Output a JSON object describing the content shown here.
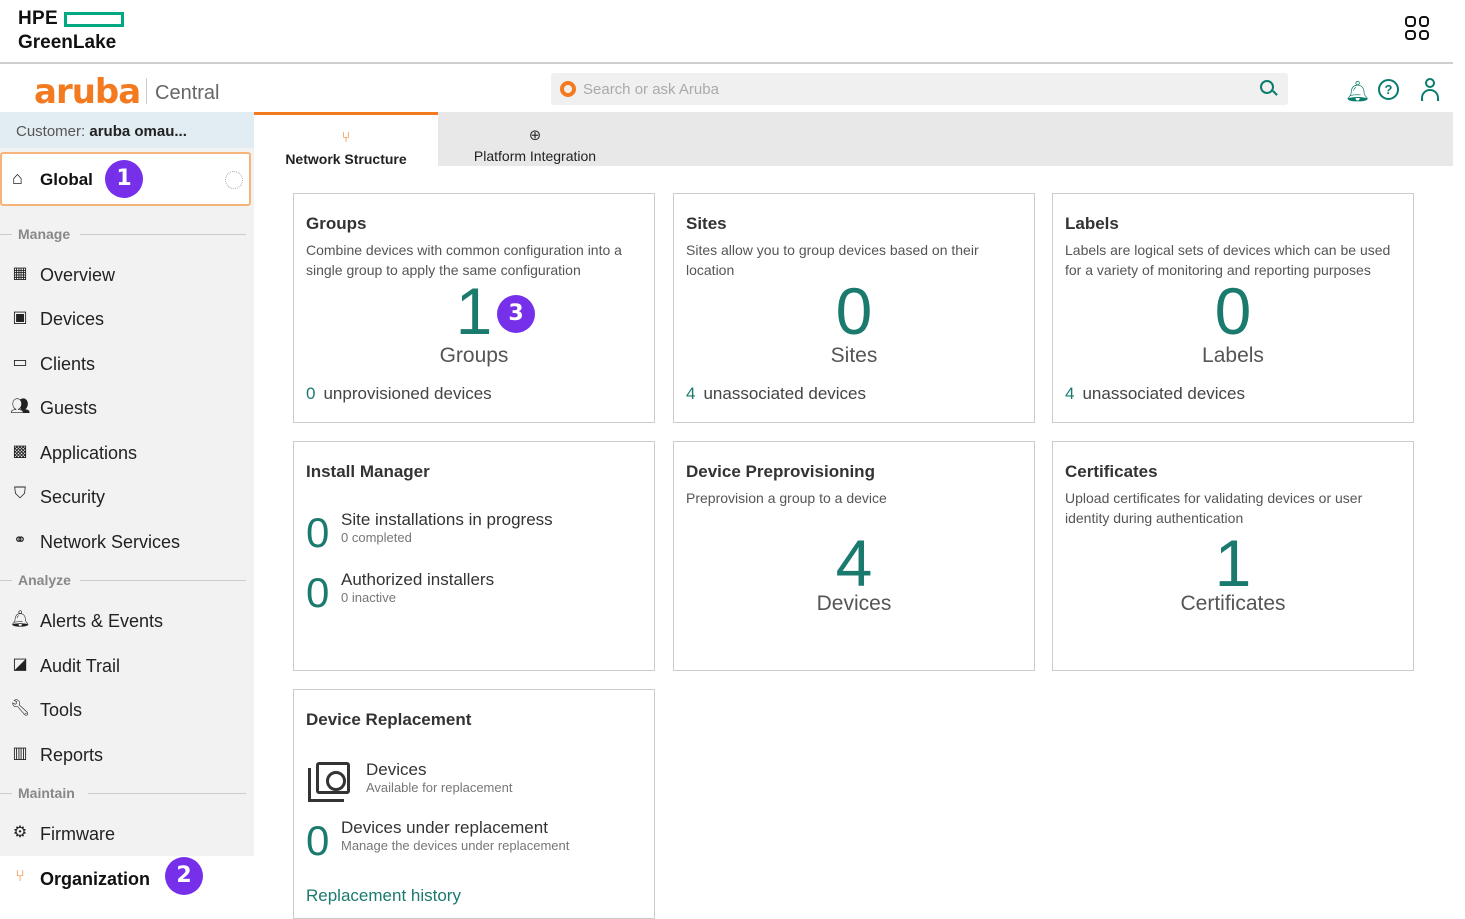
{
  "hpe": {
    "brand": "HPE",
    "product": "GreenLake"
  },
  "aruba": {
    "brand": "aruba",
    "product": "Central",
    "search_placeholder": "Search or ask Aruba"
  },
  "sidebar": {
    "customer_label": "Customer: ",
    "customer_name": "aruba omau...",
    "scope": "Global",
    "sections": {
      "manage": "Manage",
      "analyze": "Analyze",
      "maintain": "Maintain"
    },
    "items": {
      "overview": "Overview",
      "devices": "Devices",
      "clients": "Clients",
      "guests": "Guests",
      "applications": "Applications",
      "security": "Security",
      "network_services": "Network Services",
      "alerts_events": "Alerts & Events",
      "audit_trail": "Audit Trail",
      "tools": "Tools",
      "reports": "Reports",
      "firmware": "Firmware",
      "organization": "Organization"
    },
    "active_item": "Organization"
  },
  "badges": {
    "b1": "1",
    "b2": "2",
    "b3": "3"
  },
  "tabs": {
    "network_structure": "Network Structure",
    "platform_integration": "Platform Integration",
    "active": "Network Structure"
  },
  "cards": {
    "groups": {
      "title": "Groups",
      "desc": "Combine devices with common configuration into a single group to apply the same configuration",
      "count": "1",
      "count_label": "Groups",
      "foot_num": "0",
      "foot_text": "unprovisioned devices"
    },
    "sites": {
      "title": "Sites",
      "desc": "Sites allow you to group devices based on their location",
      "count": "0",
      "count_label": "Sites",
      "foot_num": "4",
      "foot_text": "unassociated devices"
    },
    "labels": {
      "title": "Labels",
      "desc": "Labels are logical sets of devices which can be used for a variety of monitoring and reporting purposes",
      "count": "0",
      "count_label": "Labels",
      "foot_num": "4",
      "foot_text": "unassociated devices"
    },
    "install_manager": {
      "title": "Install Manager",
      "site_num": "0",
      "site_title": "Site installations in progress",
      "site_sub": "0 completed",
      "inst_num": "0",
      "inst_title": "Authorized installers",
      "inst_sub": "0 inactive"
    },
    "preprovisioning": {
      "title": "Device Preprovisioning",
      "desc": "Preprovision a group to a device",
      "count": "4",
      "count_label": "Devices"
    },
    "certificates": {
      "title": "Certificates",
      "desc": "Upload certificates for validating devices or user identity during authentication",
      "count": "1",
      "count_label": "Certificates"
    },
    "replacement": {
      "title": "Device Replacement",
      "dev_title": "Devices",
      "dev_sub": "Available for replacement",
      "under_num": "0",
      "under_title": "Devices under replacement",
      "under_sub": "Manage the devices under replacement",
      "history_link": "Replacement history"
    }
  },
  "colors": {
    "accent_orange": "#f47a20",
    "teal": "#1a7a6e",
    "badge_purple": "#7630ea",
    "hpe_green": "#01a982"
  }
}
